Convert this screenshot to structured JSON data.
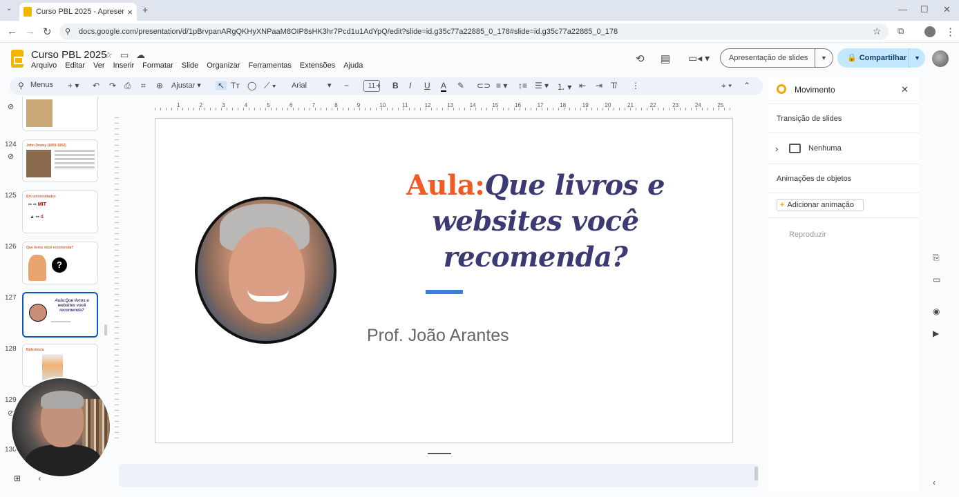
{
  "browser": {
    "tab_title": "Curso PBL 2025 - Apresentaçõ",
    "url": "docs.google.com/presentation/d/1pBrvpanARgQKHyXNPaaM8OIP8sHK3hr7Pcd1u1AdYpQ/edit?slide=id.g35c77a22885_0_178#slide=id.g35c77a22885_0_178"
  },
  "doc": {
    "title": "Curso PBL 2025",
    "menus": [
      "Arquivo",
      "Editar",
      "Ver",
      "Inserir",
      "Formatar",
      "Slide",
      "Organizar",
      "Ferramentas",
      "Extensões",
      "Ajuda"
    ],
    "slideshow_label": "Apresentação de slides",
    "share_label": "Compartilhar"
  },
  "toolbar": {
    "menus_label": "Menus",
    "zoom_label": "Ajustar",
    "font": "Arial",
    "font_size": "11"
  },
  "ruler": {
    "ticks": [
      "1",
      "2",
      "3",
      "4",
      "5",
      "6",
      "7",
      "8",
      "9",
      "10",
      "11",
      "12",
      "13",
      "14",
      "15",
      "16",
      "17",
      "18",
      "19",
      "20",
      "21",
      "22",
      "23",
      "24",
      "25"
    ]
  },
  "filmstrip": {
    "slides": [
      {
        "num": "124"
      },
      {
        "num": "125"
      },
      {
        "num": "126"
      },
      {
        "num": "127"
      },
      {
        "num": "128"
      },
      {
        "num": "129"
      },
      {
        "num": "130"
      }
    ],
    "thumb_127_title": "Aula:Que livros e websites você recomenda?",
    "thumb_124_title": "John Dewey (1859-1952)",
    "thumb_125_title": "Em universidades",
    "thumb_126_title": "Que livros você recomenda?",
    "thumb_128_title": "Referência"
  },
  "slide": {
    "title_keyword": "Aula:",
    "title_rest": "Que livros e websites você recomenda?",
    "presenter": "Prof. João Arantes"
  },
  "panel": {
    "title": "Movimento",
    "transition_header": "Transição de slides",
    "transition_value": "Nenhuma",
    "animations_header": "Animações de objetos",
    "add_animation": "Adicionar animação",
    "play": "Reproduzir"
  },
  "colors": {
    "title_keyword": "#f15a22",
    "title_text": "#3c3a72",
    "accent_bar": "#3b7fd9",
    "share_bg": "#c2e7ff"
  }
}
